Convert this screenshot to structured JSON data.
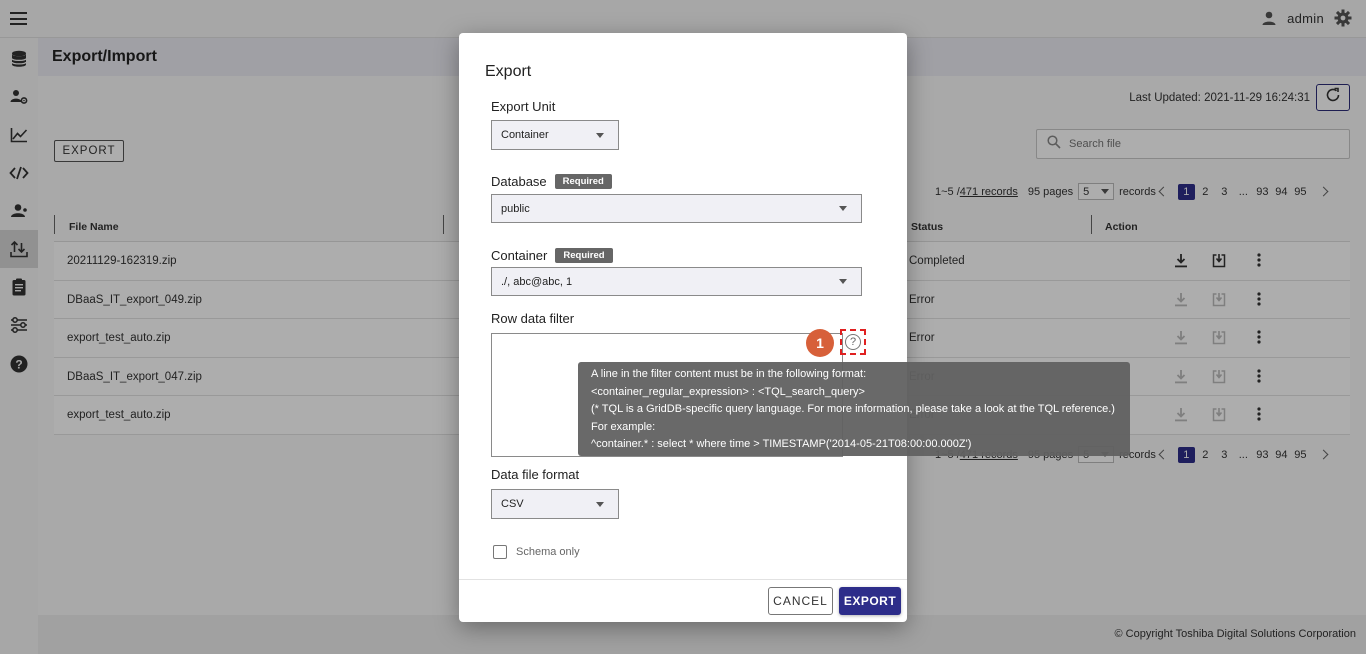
{
  "topbar": {
    "user": "admin"
  },
  "page": {
    "title": "Export/Import",
    "last_updated": "Last Updated: 2021-11-29 16:24:31",
    "export_button": "EXPORT",
    "search_placeholder": "Search file"
  },
  "pagination": {
    "range": "1~5 / ",
    "records": "471 records",
    "pages_label": "95 pages",
    "per_page": "5",
    "records_label": "records",
    "pages": [
      "1",
      "2",
      "3"
    ],
    "ellipsis": "...",
    "last_pages": [
      "93",
      "94",
      "95"
    ]
  },
  "table": {
    "headers": {
      "file_name": "File Name",
      "status": "Status",
      "action": "Action"
    },
    "rows": [
      {
        "file": "20211129-162319.zip",
        "status": "Completed"
      },
      {
        "file": "DBaaS_IT_export_049.zip",
        "status": "Error"
      },
      {
        "file": "export_test_auto.zip",
        "status": "Error"
      },
      {
        "file": "DBaaS_IT_export_047.zip",
        "status": "Error"
      },
      {
        "file": "export_test_auto.zip",
        "status": "Error"
      }
    ]
  },
  "footer": {
    "copyright": "© Copyright Toshiba Digital Solutions Corporation"
  },
  "dialog": {
    "title": "Export",
    "export_unit": {
      "label": "Export Unit",
      "value": "Container"
    },
    "database": {
      "label": "Database",
      "badge": "Required",
      "value": "public"
    },
    "container": {
      "label": "Container",
      "badge": "Required",
      "value": "./, abc@abc, 1"
    },
    "row_filter": {
      "label": "Row data filter",
      "value": ""
    },
    "data_format": {
      "label": "Data file format",
      "value": "CSV"
    },
    "schema_only": "Schema only",
    "cancel": "CANCEL",
    "export": "EXPORT",
    "step_badge": "1",
    "help_symbol": "?"
  },
  "tooltip": {
    "lines": [
      "A line in the filter content must be in the following format:",
      "<container_regular_expression> : <TQL_search_query>",
      "(* TQL is a GridDB-specific query language. For more information, please take a look at the TQL reference.)",
      "For example:",
      "^container.* : select * where time > TIMESTAMP('2014-05-21T08:00:00.000Z')"
    ]
  },
  "icons": {
    "topbar": [
      "menu-icon",
      "user-icon",
      "gear-icon"
    ],
    "sidebar": [
      "database-icon",
      "user-settings-icon",
      "line-chart-icon",
      "code-icon",
      "users-icon",
      "export-import-icon",
      "clipboard-icon",
      "settings-sliders-icon",
      "help-icon"
    ],
    "row_actions": [
      "download-icon",
      "import-icon",
      "more-icon"
    ]
  },
  "colors": {
    "primary": "#2d2d8a",
    "badge_step": "#d7603a",
    "highlight_dashed": "#e02020"
  }
}
